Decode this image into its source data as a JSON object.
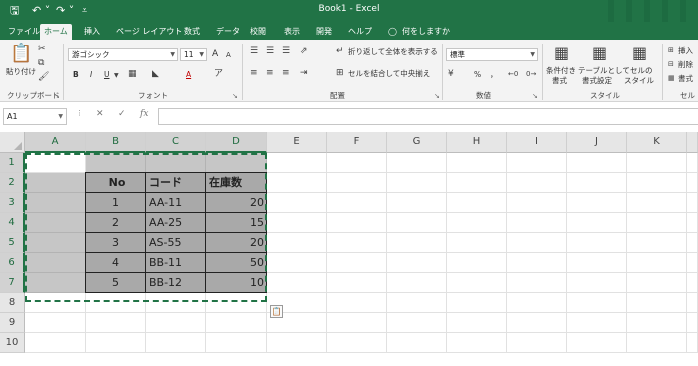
{
  "titlebar": {
    "title": "Book1  -  Excel",
    "qa_icons": [
      "save-icon",
      "undo-icon",
      "redo-icon",
      "customize-icon"
    ],
    "qa_glyphs": [
      "🖫",
      "↶ ˅",
      "↷ ˅",
      "⩡"
    ]
  },
  "tabs": [
    "ファイル",
    "ホーム",
    "挿入",
    "ページ レイアウト",
    "数式",
    "データ",
    "校閲",
    "表示",
    "開発",
    "ヘルプ"
  ],
  "tell_me": "何をしますか",
  "ribbon": {
    "clipboard": {
      "paste_label": "貼り付け",
      "group": "クリップボード"
    },
    "font": {
      "name": "游ゴシック",
      "size": "11",
      "grow": "A",
      "shrink": "A",
      "bold": "B",
      "italic": "I",
      "underline": "U",
      "font_color": "A",
      "group": "フォント"
    },
    "alignment": {
      "wrap_text": "折り返して全体を表示する",
      "merge_center": "セルを結合して中央揃え",
      "group": "配置"
    },
    "number": {
      "format": "標準",
      "percent": "%",
      "comma": "，",
      "group": "数値"
    },
    "styles": {
      "conditional_line1": "条件付き",
      "conditional_line2": "書式",
      "table_line1": "テーブルとして",
      "table_line2": "書式設定",
      "cell_styles_line1": "セルの",
      "cell_styles_line2": "スタイル",
      "group": "スタイル"
    },
    "cells": {
      "insert": "挿入",
      "delete": "削除",
      "format": "書式",
      "group": "セル"
    }
  },
  "formula_bar": {
    "name_box": "A1",
    "cancel": "✕",
    "enter": "✓",
    "fx": "fx",
    "value": ""
  },
  "columns": [
    "A",
    "B",
    "C",
    "D",
    "E",
    "F",
    "G",
    "H",
    "I",
    "J",
    "K"
  ],
  "rows": [
    "1",
    "2",
    "3",
    "4",
    "5",
    "6",
    "7",
    "8",
    "9",
    "10"
  ],
  "table": {
    "headers": [
      "No",
      "コード",
      "在庫数"
    ],
    "data": [
      [
        "1",
        "AA-11",
        "20"
      ],
      [
        "2",
        "AA-25",
        "15"
      ],
      [
        "3",
        "AS-55",
        "20"
      ],
      [
        "4",
        "BB-11",
        "50"
      ],
      [
        "5",
        "BB-12",
        "10"
      ]
    ]
  },
  "paste_options_icon": "paste-options-icon",
  "colors": {
    "accent": "#217346",
    "table_fill": "#a9a9a9",
    "selection_fill": "#c6c6c6"
  }
}
